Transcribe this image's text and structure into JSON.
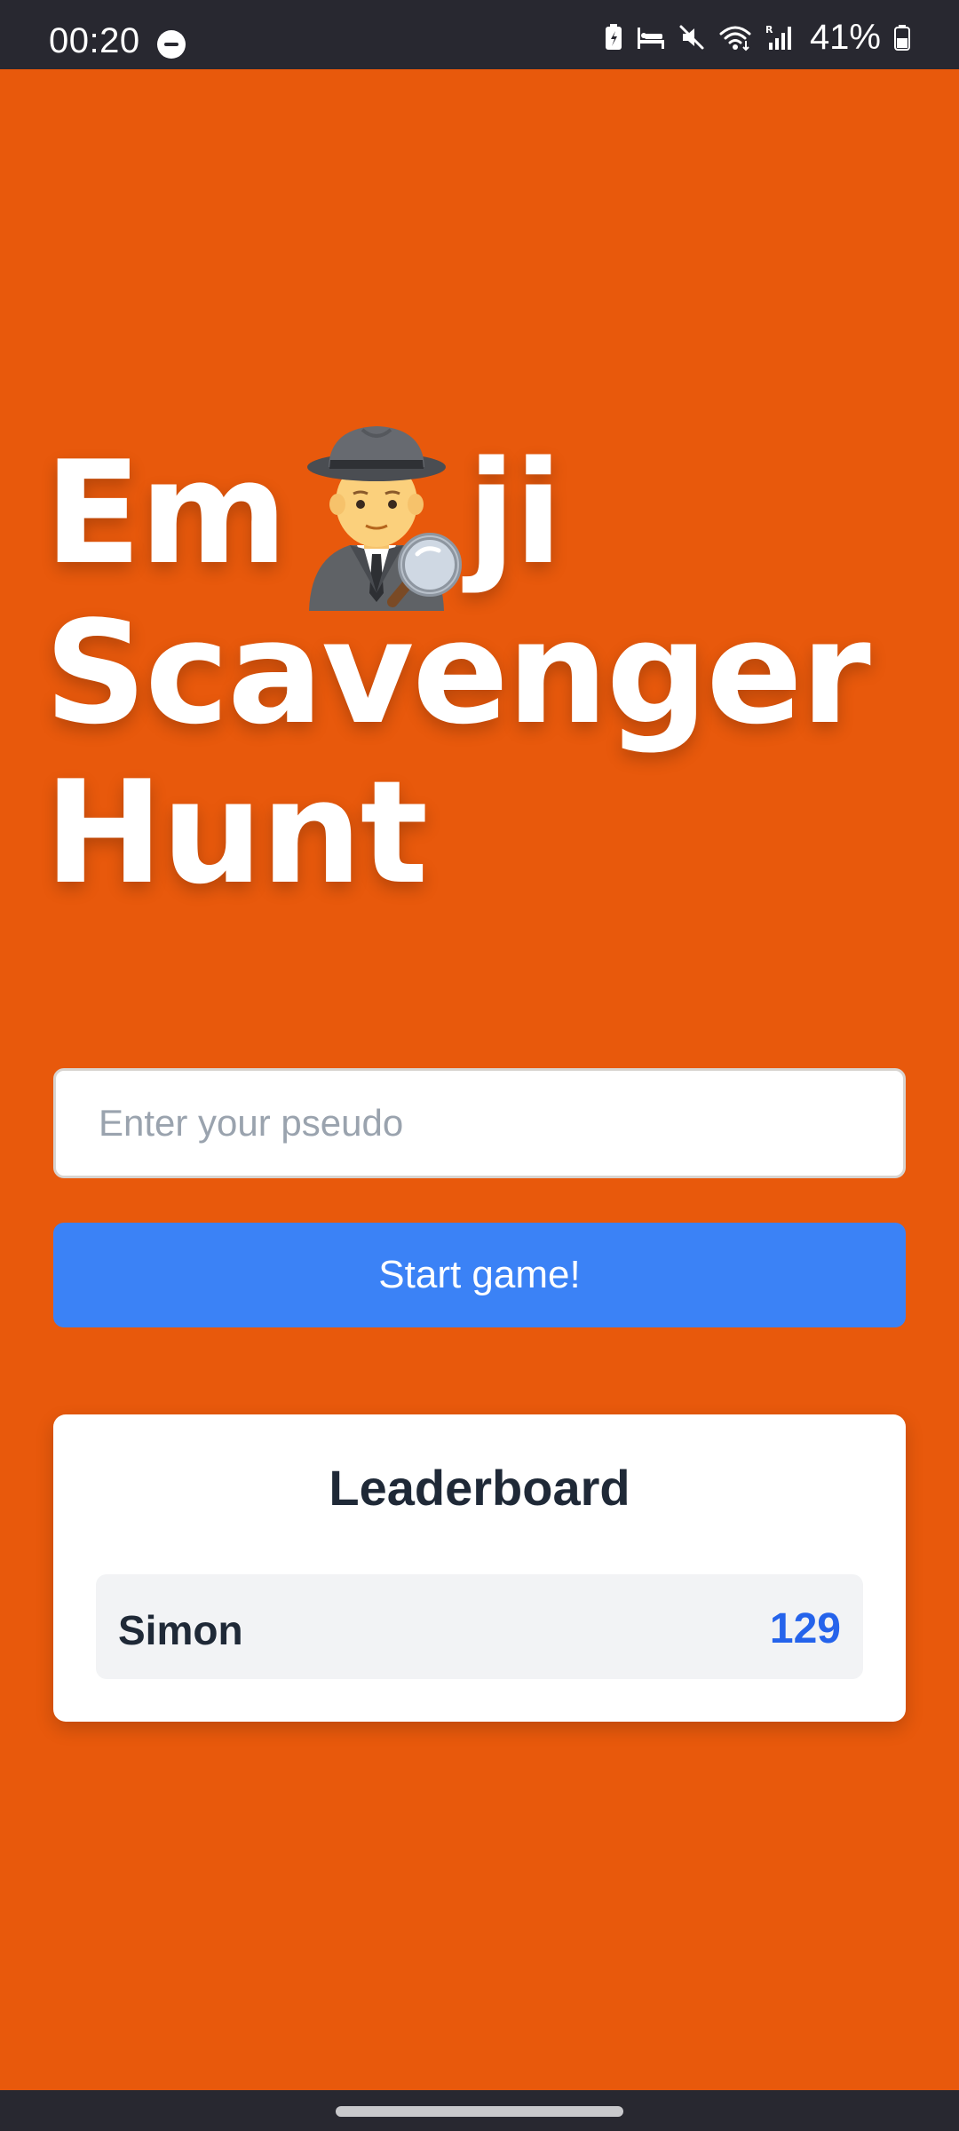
{
  "status_bar": {
    "time": "00:20",
    "battery_text": "41%",
    "icons": [
      "do-not-disturb-icon",
      "battery-saver-icon",
      "sleep-mode-icon",
      "mute-icon",
      "wifi-icon",
      "signal-icon",
      "battery-icon"
    ]
  },
  "title": {
    "part1": "Em",
    "emoji": "detective-emoji-icon",
    "part2": "ji",
    "line2": "Scavenger",
    "line3": "Hunt"
  },
  "form": {
    "placeholder": "Enter your pseudo",
    "value": "",
    "start_label": "Start game!"
  },
  "leaderboard": {
    "title": "Leaderboard",
    "entries": [
      {
        "name": "Simon",
        "score": "129"
      }
    ]
  },
  "colors": {
    "background": "#e8590c",
    "button": "#3b82f6",
    "score": "#2563eb",
    "system_bars": "#282830"
  }
}
